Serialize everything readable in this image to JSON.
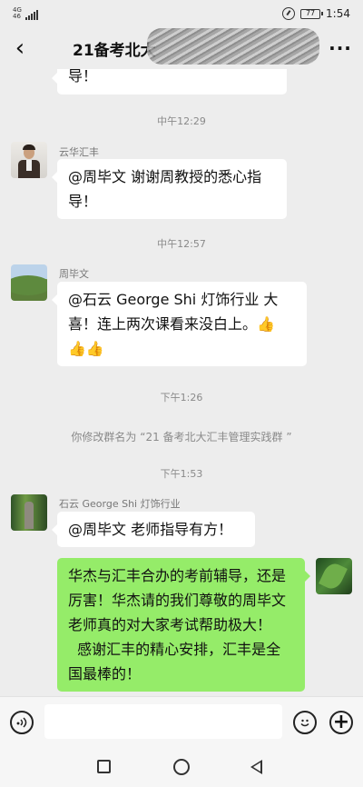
{
  "status_bar": {
    "network": "4G",
    "network_sub": "46",
    "battery": "77",
    "time": "1:54"
  },
  "header": {
    "back_icon": "‹",
    "title": "21备考北大",
    "more_icon": "···"
  },
  "messages": {
    "m0": {
      "line": "导！"
    },
    "t1": "中午12:29",
    "m1": {
      "sender": "云华汇丰",
      "line1": "@周毕文  谢谢周教授的悉心指",
      "line2": "导！"
    },
    "t2": "中午12:57",
    "m2": {
      "sender": "周毕文",
      "line1": "@石云 George Shi 灯饰行业  大",
      "line2": "喜！连上两次课看来没白上。👍",
      "line3": "👍👍"
    },
    "t3": "下午1:26",
    "sys": "你修改群名为 “21 备考北大汇丰管理实践群 ”",
    "t4": "下午1:53",
    "m3": {
      "sender": "石云 George Shi 灯饰行业",
      "line": "@周毕文  老师指导有方！"
    },
    "m4": {
      "line1": "华杰与汇丰合办的考前辅导，还是",
      "line2": "厉害！华杰请的我们尊敬的周毕文",
      "line3": "老师真的对大家考试帮助极大！",
      "line4": "  感谢汇丰的精心安排，汇丰是全",
      "line5": "国最棒的！"
    }
  },
  "input_bar": {
    "voice_icon": "voice-icon",
    "emoji_icon": "emoji-icon",
    "plus_label": "+"
  }
}
